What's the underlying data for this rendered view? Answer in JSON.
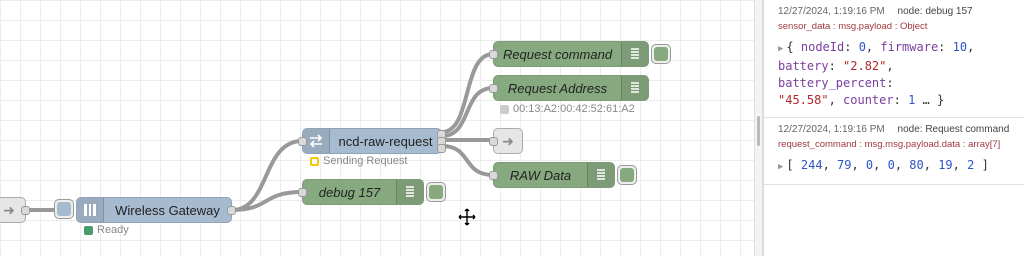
{
  "flow": {
    "nodes": {
      "wireless_gateway": "Wireless Gateway",
      "ncd_raw_request": "ncd-raw-request",
      "debug_157": "debug 157",
      "request_command": "Request command",
      "request_address": "Request Address",
      "raw_data": "RAW Data"
    },
    "status": {
      "gateway": "Ready",
      "ncd_raw_request": "Sending Request",
      "request_address": "00:13:A2:00:42:52:61:A2"
    }
  },
  "debug": {
    "messages": [
      {
        "timestamp": "12/27/2024, 1:19:16 PM",
        "node": "node: debug 157",
        "topic": "sensor_data : msg.payload : Object",
        "payload": {
          "line1_k1": "nodeId",
          "line1_v1": "0",
          "line1_k2": "firmware",
          "line1_v2": "10",
          "line2_k1": "battery",
          "line2_v1": "\"2.82\"",
          "line2_k2": "battery_percent",
          "line3_v1": "\"45.58\"",
          "line3_k2": "counter",
          "line3_v2": "1",
          "ellipsis": "…"
        }
      },
      {
        "timestamp": "12/27/2024, 1:19:16 PM",
        "node": "node: Request command",
        "topic": "request_command : msg.msg.payload.data : array[7]",
        "payload": {
          "values": [
            "244",
            "79",
            "0",
            "0",
            "80",
            "19",
            "2"
          ]
        }
      }
    ]
  },
  "colors": {
    "function_green": "#87a980",
    "request_blue": "#a6bbcf",
    "status_green": "#4a9c6b",
    "status_yellow": "#f0c808"
  }
}
